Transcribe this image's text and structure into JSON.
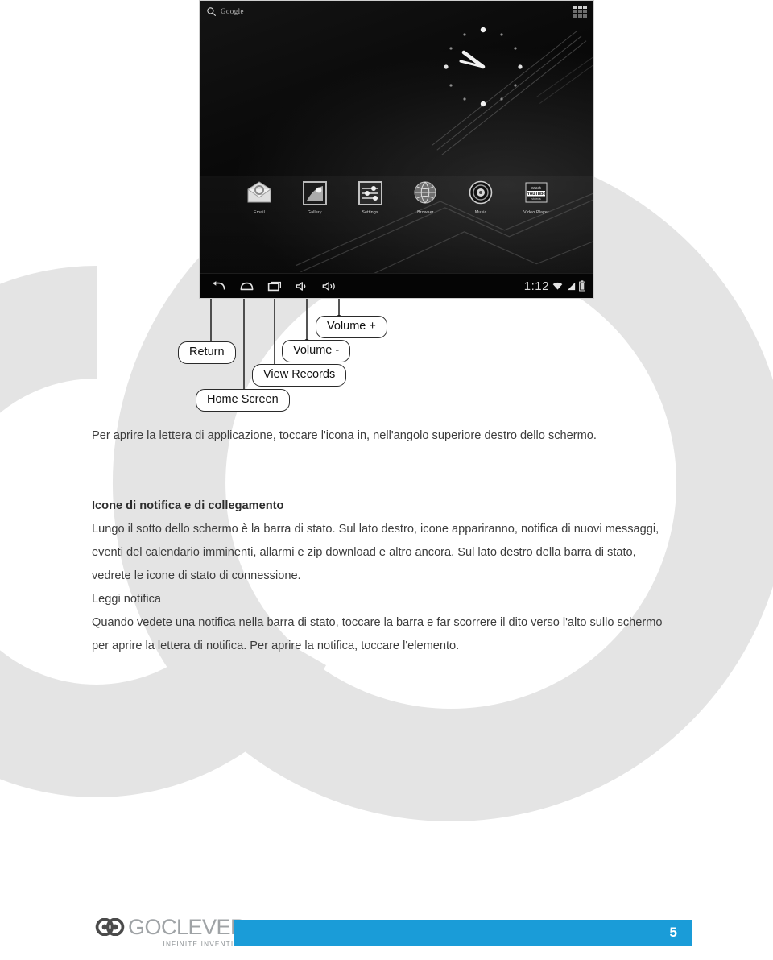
{
  "page": {
    "number": "5",
    "accent_color": "#1a9cd8",
    "watermark_color": "#e3e3e3"
  },
  "figure": {
    "name": "tablet-home-screen-illustration",
    "tablet": {
      "search_label": "Google",
      "search_icon": "search-icon",
      "apps_grid_icon": "apps-grid-icon",
      "clock_time": "1:12",
      "apps": [
        {
          "label": "Email",
          "icon": "email-icon"
        },
        {
          "label": "Gallery",
          "icon": "gallery-icon"
        },
        {
          "label": "Settings",
          "icon": "settings-icon"
        },
        {
          "label": "Browser",
          "icon": "browser-globe-icon"
        },
        {
          "label": "Music",
          "icon": "music-speaker-icon"
        },
        {
          "label": "Video Player",
          "icon": "video-player-youtube-icon"
        }
      ],
      "nav_icons": [
        "back-icon",
        "home-icon",
        "recent-apps-icon",
        "volume-down-icon",
        "volume-up-icon"
      ],
      "status_icons": [
        "wifi-icon",
        "signal-icon",
        "battery-icon"
      ]
    },
    "callouts": [
      {
        "label": "Return",
        "target": "back-icon"
      },
      {
        "label": "Home Screen",
        "target": "home-icon"
      },
      {
        "label": "View Records",
        "target": "recent-apps-icon"
      },
      {
        "label": "Volume -",
        "target": "volume-down-icon"
      },
      {
        "label": "Volume +",
        "target": "volume-up-icon"
      }
    ]
  },
  "body": {
    "intro_paragraph": "Per aprire la lettera di applicazione, toccare l'icona in, nell'angolo superiore destro dello schermo.",
    "section_heading": "Icone di notifica e di collegamento",
    "section_paragraph": "Lungo il sotto dello schermo è la barra di stato. Sul lato destro, icone appariranno, notifica di nuovi messaggi, eventi del calendario imminenti, allarmi e zip download e altro ancora. Sul lato destro della barra di stato, vedrete le icone di stato di connessione.",
    "subsection_heading": "Leggi notifica",
    "subsection_paragraph": "Quando vedete una notifica nella barra di stato, toccare la barra e far scorrere il dito verso l'alto sullo schermo per aprire la lettera di notifica. Per aprire la notifica, toccare l'elemento."
  },
  "footer": {
    "logo_mark": "go-logo-mark",
    "logo_word": "GOCLEVER",
    "logo_tagline": "INFINITE INVENTION",
    "page_number": "5"
  }
}
